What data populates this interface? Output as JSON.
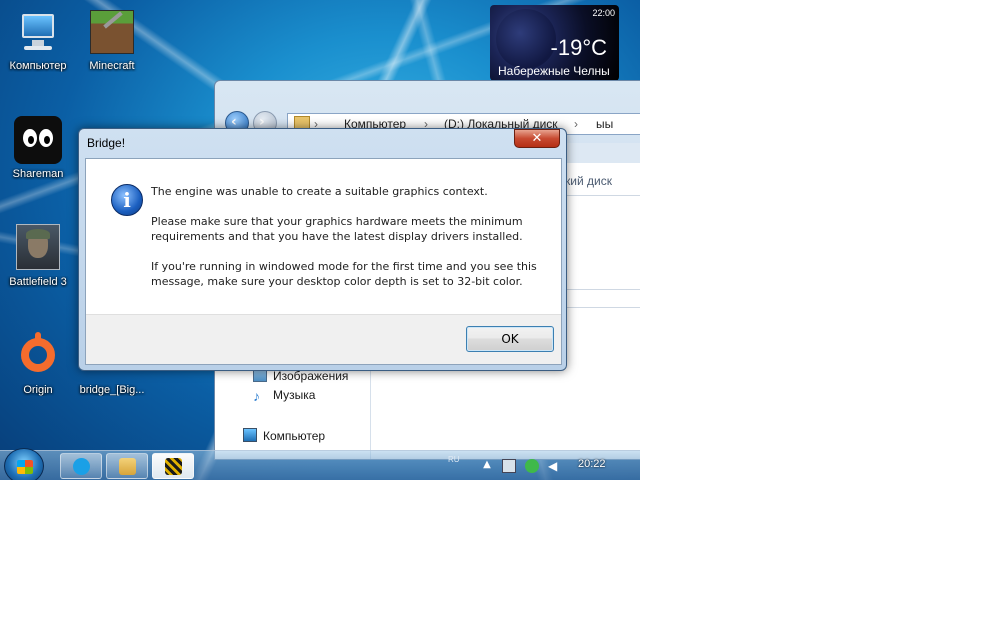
{
  "desktop": {
    "icons": [
      {
        "label": "Компьютер",
        "icon": "computer-icon"
      },
      {
        "label": "Minecraft",
        "icon": "minecraft-icon"
      },
      {
        "label": "Shareman",
        "icon": "shareman-icon"
      },
      {
        "label": "Battlefield 3",
        "icon": "battlefield3-icon"
      },
      {
        "label": "Origin",
        "icon": "origin-icon"
      },
      {
        "label": "bridge_[Big...",
        "icon": "bridge-file-icon"
      }
    ]
  },
  "weather_gadget": {
    "time": "22:00",
    "temperature": "-19°C",
    "city": "Набережные Челны"
  },
  "explorer": {
    "breadcrumbs": [
      "Компьютер",
      "(D:) Локальный диск",
      "ыы"
    ],
    "right_header": "кий диск",
    "nav_items": [
      {
        "label": "Изображения",
        "icon": "pictures-folder-icon"
      },
      {
        "label": "Музыка",
        "icon": "music-folder-icon"
      },
      {
        "label": "Компьютер",
        "icon": "computer-icon"
      }
    ]
  },
  "dialog": {
    "title": "Bridge!",
    "close_glyph": "✕",
    "icon": "info-icon",
    "message_line1": "The engine was unable to create a suitable graphics context.",
    "message_line2": "Please make sure that your graphics hardware meets the minimum requirements and that you have the latest display drivers installed.",
    "message_line3": "If you're running in windowed mode for the first time and you see this message, make sure your desktop color depth is set to 32-bit color.",
    "ok_label": "OK"
  },
  "taskbar": {
    "items": [
      "skype-icon",
      "explorer-icon",
      "bridge-app-icon"
    ],
    "tray_label": "RU",
    "clock": "20:22"
  },
  "colors": {
    "accent": "#1b5fc0",
    "close_button": "#c74a31",
    "desktop": "#1a8fce"
  }
}
